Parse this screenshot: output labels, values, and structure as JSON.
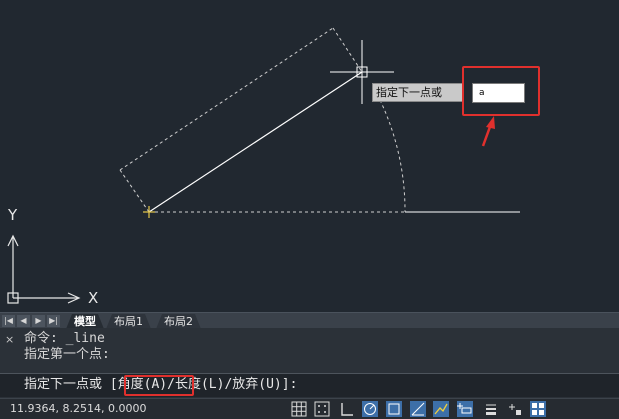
{
  "canvas": {
    "tooltip_label": "指定下一点或",
    "input_value": "a",
    "ucs_y_label": "Y",
    "ucs_x_label": "X"
  },
  "layout_tabs": {
    "nav": [
      "|◀",
      "◀",
      "▶",
      "▶|"
    ],
    "tabs": [
      "模型",
      "布局1",
      "布局2"
    ],
    "active_tab": "模型"
  },
  "command_line": {
    "close_label": "×",
    "history": [
      "命令: _line",
      "指定第一个点:"
    ],
    "prompt": "指定下一点或 ",
    "option_angle": "[角度(A)",
    "option_rest": "/长度(L)/放弃(U)]:"
  },
  "status_bar": {
    "coordinates": "11.9364, 8.2514, 0.0000",
    "buttons": [
      "grid-icon",
      "snap-icon",
      "ortho-icon",
      "polar-icon",
      "osnap-icon",
      "otrack-icon",
      "dynamic-ucs-icon",
      "dynamic-input-icon",
      "lineweight-icon",
      "menu-icon",
      "annotation-icon",
      "workspace-icon"
    ]
  },
  "colors": {
    "canvas_bg": "#212830",
    "highlight_red": "#e0302d",
    "line_white": "#ffffff"
  }
}
